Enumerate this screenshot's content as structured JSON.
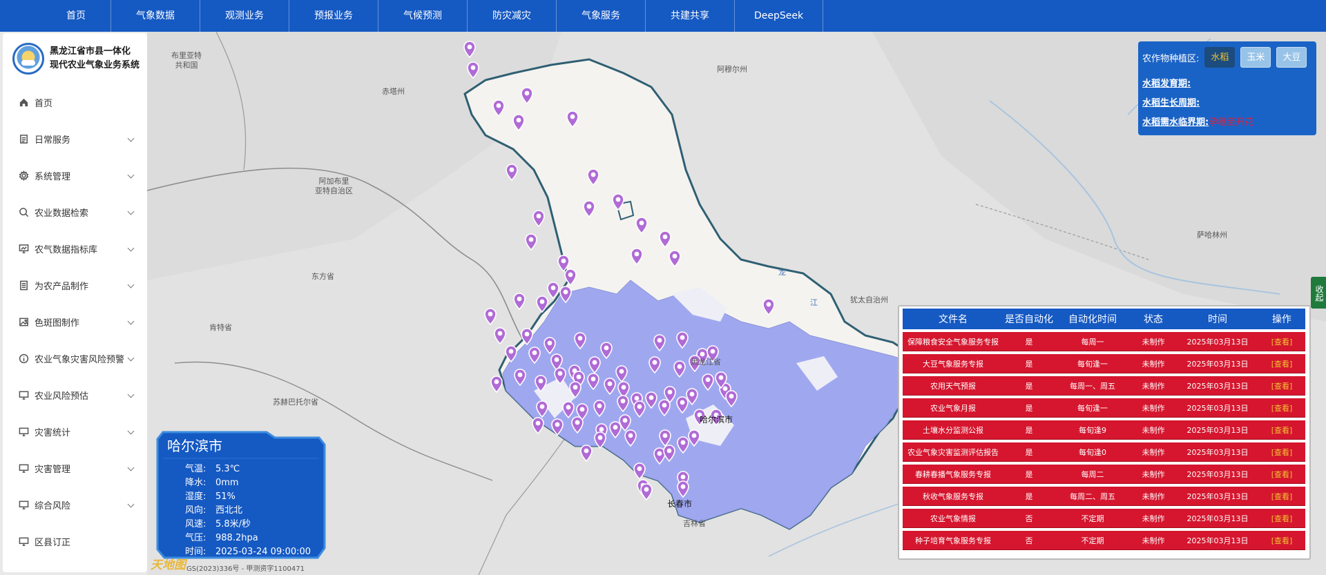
{
  "nav": {
    "items": [
      "首页",
      "气象数据",
      "观测业务",
      "预报业务",
      "气候预测",
      "防灾减灾",
      "气象服务",
      "共建共享",
      "DeepSeek"
    ]
  },
  "sidebar": {
    "logo_line1": "黑龙江省市县一体化",
    "logo_line2": "现代农业气象业务系统",
    "items": [
      {
        "label": "首页",
        "icon": "home-icon",
        "expandable": false
      },
      {
        "label": "日常服务",
        "icon": "document-icon",
        "expandable": true
      },
      {
        "label": "系统管理",
        "icon": "gear-icon",
        "expandable": true
      },
      {
        "label": "农业数据检索",
        "icon": "search-icon",
        "expandable": true
      },
      {
        "label": "农气数据指标库",
        "icon": "chart-screen-icon",
        "expandable": true
      },
      {
        "label": "为农产品制作",
        "icon": "list-document-icon",
        "expandable": true
      },
      {
        "label": "色斑图制作",
        "icon": "image-icon",
        "expandable": true
      },
      {
        "label": "农业气象灾害风险预警",
        "icon": "info-icon",
        "expandable": true
      },
      {
        "label": "农业风险预估",
        "icon": "screen-icon",
        "expandable": true
      },
      {
        "label": "灾害统计",
        "icon": "screen-icon",
        "expandable": true
      },
      {
        "label": "灾害管理",
        "icon": "screen-icon",
        "expandable": true
      },
      {
        "label": "综合风险",
        "icon": "screen-icon",
        "expandable": true
      },
      {
        "label": "区县订正",
        "icon": "screen-icon",
        "expandable": false
      }
    ]
  },
  "map": {
    "labels": {
      "bryatia": "布里亚特\n共和国",
      "chita": "赤塔州",
      "amur": "阿穆尔州",
      "aginsk": "阿加布里\n亚特自治区",
      "eastern": "东方省",
      "khentii": "肯特省",
      "sukhbaatar": "苏赫巴托尔省",
      "jewish": "犹太自治州",
      "khabarovsk": "萨哈林州",
      "heilongjiang": "黑龙江省",
      "harbin": "哈尔滨市",
      "changchun": "长春市",
      "jilin": "吉林省",
      "river": "龙",
      "river2": "江"
    }
  },
  "crop_panel": {
    "title": "农作物种植区:",
    "options": [
      "水稻",
      "玉米",
      "大豆"
    ],
    "active": "水稻",
    "growth_stage_label": "水稻发育期:",
    "growth_cycle_label": "水稻生长周期:",
    "critical_water_label": "水稻需水临界期:",
    "critical_water_value": "孕穗至开花"
  },
  "collapse_label": "收起",
  "weather": {
    "city": "哈尔滨市",
    "rows": [
      {
        "k": "气温:",
        "v": "5.3℃"
      },
      {
        "k": "降水:",
        "v": "0mm"
      },
      {
        "k": "湿度:",
        "v": "51%"
      },
      {
        "k": "风向:",
        "v": "西北北"
      },
      {
        "k": "风速:",
        "v": "5.8米/秒"
      },
      {
        "k": "气压:",
        "v": "988.2hpa"
      },
      {
        "k": "时间:",
        "v": "2025-03-24 09:00:00"
      }
    ]
  },
  "watermark": "天地图",
  "copyright": "GS(2023)336号 - 甲测资字1100471",
  "table": {
    "headers": [
      "文件名",
      "是否自动化",
      "自动化时间",
      "状态",
      "时间",
      "操作"
    ],
    "rows": [
      [
        "保障粮食安全气象服务专报",
        "是",
        "每周一",
        "未制作",
        "2025年03月13日",
        "[查看]"
      ],
      [
        "大豆气象服务专报",
        "是",
        "每旬逢一",
        "未制作",
        "2025年03月13日",
        "[查看]"
      ],
      [
        "农用天气预报",
        "是",
        "每周一、周五",
        "未制作",
        "2025年03月13日",
        "[查看]"
      ],
      [
        "农业气象月报",
        "是",
        "每旬逢一",
        "未制作",
        "2025年03月13日",
        "[查看]"
      ],
      [
        "土壤水分监测公报",
        "是",
        "每旬逢9",
        "未制作",
        "2025年03月13日",
        "[查看]"
      ],
      [
        "农业气象灾害监测评估报告",
        "是",
        "每旬逢0",
        "未制作",
        "2025年03月13日",
        "[查看]"
      ],
      [
        "春耕春播气象服务专报",
        "是",
        "每周二",
        "未制作",
        "2025年03月13日",
        "[查看]"
      ],
      [
        "秋收气象服务专报",
        "是",
        "每周二、周五",
        "未制作",
        "2025年03月13日",
        "[查看]"
      ],
      [
        "农业气象情报",
        "否",
        "不定期",
        "未制作",
        "2025年03月13日",
        "[查看]"
      ],
      [
        "种子培育气象服务专报",
        "否",
        "不定期",
        "未制作",
        "2025年03月13日",
        "[查看]"
      ]
    ]
  },
  "colors": {
    "nav_bg": "#1559c3",
    "map_region_fill": "#9fa8ef",
    "province_fill": "#f4f3ef",
    "marker": "#b06bd6",
    "table_row": "#d5162e",
    "crop_active_text": "#f3c12c"
  }
}
